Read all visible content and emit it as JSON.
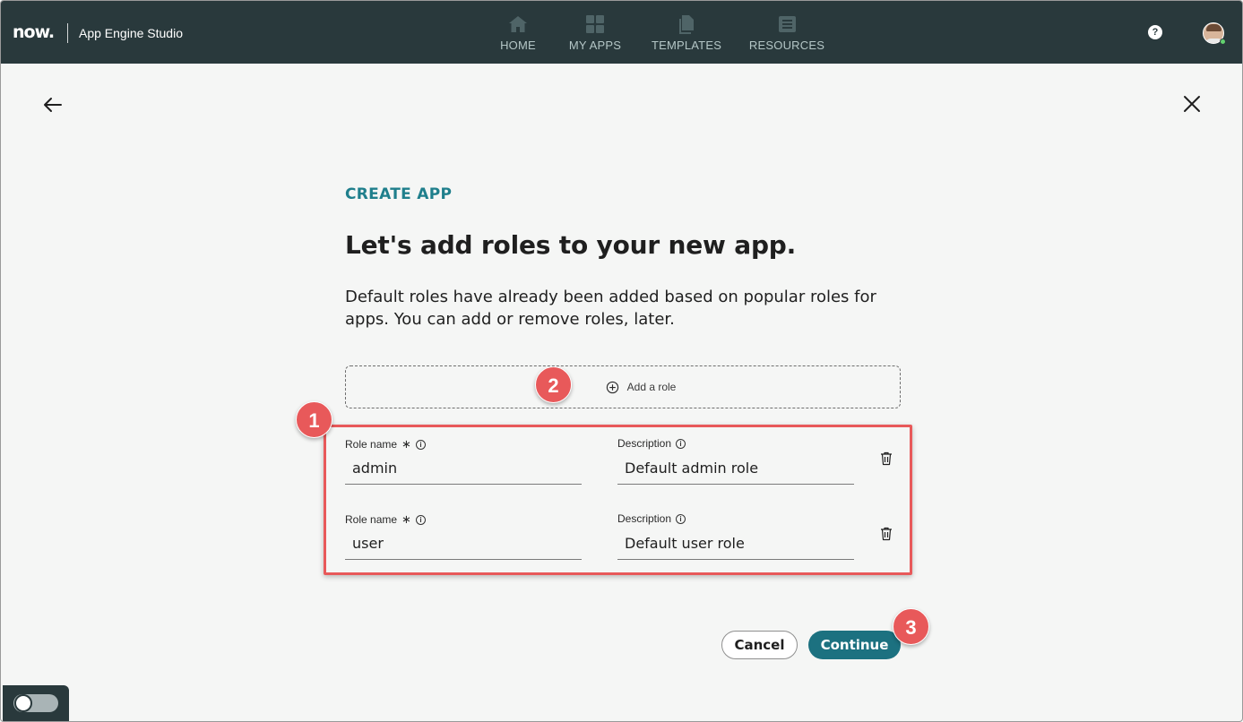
{
  "app": {
    "logo_text": "now.",
    "title": "App Engine Studio"
  },
  "nav": {
    "home": {
      "label": "HOME",
      "icon": "home-icon"
    },
    "myapps": {
      "label": "MY APPS",
      "icon": "grid-icon"
    },
    "templates": {
      "label": "TEMPLATES",
      "icon": "templates-icon"
    },
    "resources": {
      "label": "RESOURCES",
      "icon": "resources-icon"
    }
  },
  "header": {
    "help_icon_glyph": "?"
  },
  "page": {
    "eyebrow": "CREATE APP",
    "heading": "Let's add roles to your new app.",
    "intro": "Default roles have already been added based on popular roles for apps. You can add or remove roles, later.",
    "add_role_label": "Add a role"
  },
  "roles": [
    {
      "name_label": "Role name",
      "required_mark": "∗",
      "name_value": "admin",
      "desc_label": "Description",
      "desc_value": "Default admin role"
    },
    {
      "name_label": "Role name",
      "required_mark": "∗",
      "name_value": "user",
      "desc_label": "Description",
      "desc_value": "Default user role"
    }
  ],
  "info_glyph": "i",
  "actions": {
    "cancel_label": "Cancel",
    "continue_label": "Continue"
  },
  "callouts": {
    "one": "1",
    "two": "2",
    "three": "3"
  },
  "colors": {
    "topbar": "#29393c",
    "accent": "#1c7180",
    "eyebrow": "#1f7f8c",
    "callout": "#e8595a"
  }
}
